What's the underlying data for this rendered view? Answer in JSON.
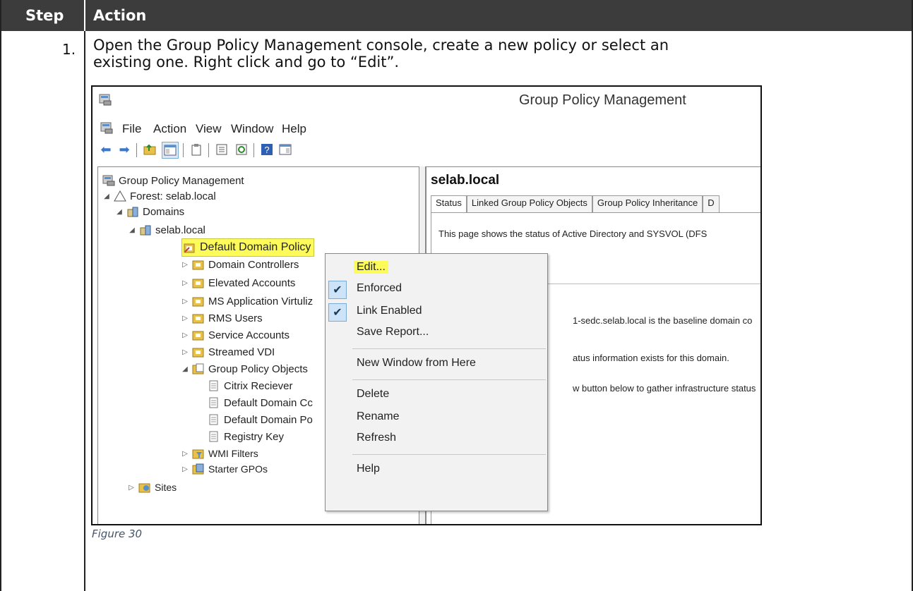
{
  "table": {
    "header_step": "Step",
    "header_action": "Action",
    "step_number": "1.",
    "instruction_line1": "Open the Group Policy Management console, create a new policy or select an",
    "instruction_line2": "existing one. Right click and go to “Edit”.",
    "caption": "Figure 30"
  },
  "window": {
    "title": "Group Policy Management",
    "menu": [
      "File",
      "Action",
      "View",
      "Window",
      "Help"
    ]
  },
  "tree": {
    "root": "Group Policy Management",
    "forest": "Forest: selab.local",
    "domains": "Domains",
    "domain": "selab.local",
    "selected": "Default Domain Policy",
    "ous": [
      "Domain Controllers",
      "Elevated Accounts",
      "MS Application Virtuliz",
      "RMS Users",
      "Service Accounts",
      "Streamed VDI"
    ],
    "gpo_folder": "Group Policy Objects",
    "gpos": [
      "Citrix Reciever",
      "Default Domain Cc",
      "Default Domain Po",
      "Registry Key"
    ],
    "wmi": "WMI Filters",
    "starter": "Starter GPOs",
    "sites": "Sites"
  },
  "right_pane": {
    "title": "selab.local",
    "tabs": [
      "Status",
      "Linked Group Policy Objects",
      "Group Policy Inheritance",
      "D"
    ],
    "line1": "This page shows the status of Active Directory and SYSVOL (DFS",
    "line2": "1-sedc.selab.local is the baseline domain co",
    "line3": "atus information exists for this domain.",
    "line4": "w button below to gather infrastructure status"
  },
  "context_menu": {
    "edit": "Edit...",
    "enforced": "Enforced",
    "link_enabled": "Link Enabled",
    "save_report": "Save Report...",
    "new_window": "New Window from Here",
    "delete": "Delete",
    "rename": "Rename",
    "refresh": "Refresh",
    "help": "Help",
    "check_mark": "✔"
  },
  "colors": {
    "header_bg": "#3c3c3c",
    "highlight": "#fdfb5a",
    "caption": "#44546a"
  }
}
